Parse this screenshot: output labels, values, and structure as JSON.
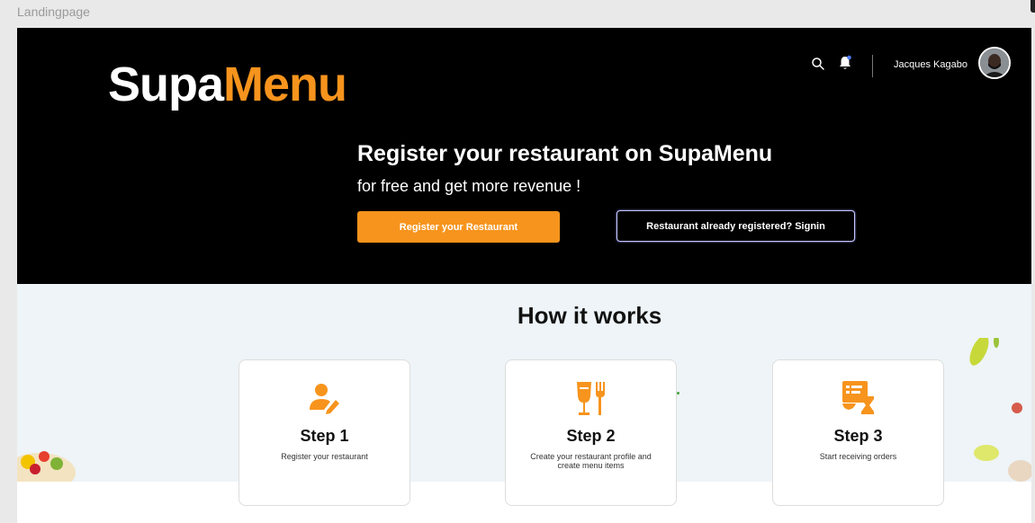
{
  "frame": {
    "label": "Landingpage"
  },
  "header": {
    "logo": {
      "part1": "Supa",
      "part2": "Menu"
    },
    "user": {
      "name": "Jacques Kagabo"
    },
    "icons": [
      "search-icon",
      "bell-icon",
      "avatar"
    ]
  },
  "hero": {
    "title": "Register your restaurant on SupaMenu",
    "subtitle": "for free and get more revenue !",
    "register_button": "Register your Restaurant",
    "signin_button": "Restaurant already registered? Signin"
  },
  "how_it_works": {
    "title": "How it works",
    "steps": [
      {
        "title": "Step 1",
        "description": "Register your restaurant",
        "icon": "user-edit-icon"
      },
      {
        "title": "Step 2",
        "description": "Create your restaurant profile and create menu items",
        "icon": "food-drink-icon"
      },
      {
        "title": "Step 3",
        "description": "Start receiving orders",
        "icon": "order-timer-icon"
      }
    ]
  },
  "colors": {
    "accent": "#f7941d",
    "hero_bg": "#000000",
    "section_bg": "#eef4f7"
  }
}
